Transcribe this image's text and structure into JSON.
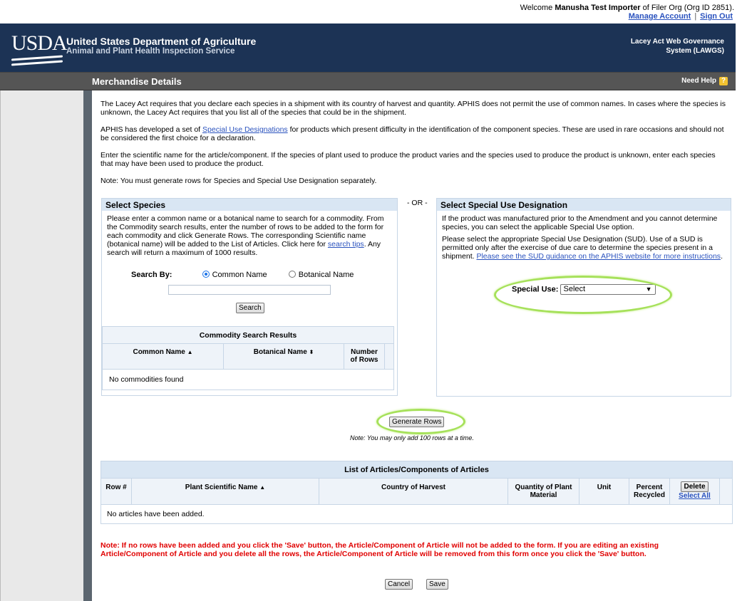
{
  "header": {
    "welcome_prefix": "Welcome",
    "user_name": "Manusha Test Importer",
    "org_text": "of Filer Org (Org ID 2851).",
    "manage_account": "Manage Account",
    "separator": "|",
    "sign_out": "Sign Out"
  },
  "banner": {
    "logo_text": "USDA",
    "dept_line1": "United States Department of Agriculture",
    "dept_line2": "Animal and Plant Health Inspection Service",
    "system_line1": "Lacey Act Web Governance",
    "system_line2": "System (LAWGS)"
  },
  "page": {
    "title": "Merchandise Details",
    "need_help": "Need Help",
    "help_glyph": "?"
  },
  "intro": {
    "p1": "The Lacey Act requires that you declare each species in a shipment with its country of harvest and quantity. APHIS does not permit the use of common names. In cases where the species is unknown, the Lacey Act requires that you list all of the species that could be in the shipment.",
    "p2_before": "APHIS has developed a set of ",
    "p2_link": "Special Use Designations",
    "p2_after": " for products which present difficulty in the identification of the component species. These are used in rare occasions and should not be considered the first choice for a declaration.",
    "p3": "Enter the scientific name for the article/component. If the species of plant used to produce the product varies and the species used to produce the product is unknown, enter each species that may have been used to produce the product.",
    "p4": "Note: You must generate rows for Species and Special Use Designation separately."
  },
  "species": {
    "heading": "Select Species",
    "desc_before": "Please enter a common name or a botanical name to search for a commodity. From the Commodity search results, enter the number of rows to be added to the form for each commodity and click Generate Rows. The corresponding Scientific name (botanical name) will be added to the List of Articles. Click here for ",
    "desc_link": "search tips",
    "desc_after": ". Any search will return a maximum of 1000 results.",
    "search_by_label": "Search By:",
    "option_common": "Common Name",
    "option_botanical": "Botanical Name",
    "selected_option": "Common Name",
    "search_value": "",
    "search_button": "Search",
    "results": {
      "caption": "Commodity Search Results",
      "col_common": "Common Name",
      "col_botanical": "Botanical Name",
      "col_rows_1": "Number",
      "col_rows_2": "of Rows",
      "sort_up": "▲",
      "sort_both": "⬍",
      "empty": "No commodities found"
    }
  },
  "or_label": "- OR -",
  "sud": {
    "heading": "Select Special Use Designation",
    "p1": "If the product was manufactured prior to the Amendment and you cannot determine species, you can select the applicable Special Use option.",
    "p2_before": "Please select the appropriate Special Use Designation (SUD). Use of a SUD is permitted only after the exercise of due care to determine the species present in a shipment. ",
    "p2_link": "Please see the SUD guidance on the APHIS website for more instructions",
    "p2_after": ".",
    "special_use_label": "Special Use:",
    "special_use_value": "Select"
  },
  "generate": {
    "button": "Generate Rows",
    "note": "Note: You may only add 100 rows at a time."
  },
  "articles": {
    "caption": "List of Articles/Components of Articles",
    "col_row": "Row #",
    "col_name": "Plant Scientific Name",
    "col_country": "Country of Harvest",
    "col_qty_1": "Quantity of Plant",
    "col_qty_2": "Material",
    "col_unit": "Unit",
    "col_pct_1": "Percent",
    "col_pct_2": "Recycled",
    "delete_button": "Delete",
    "select_all": "Select All",
    "sort_up": "▲",
    "empty": "No articles have been added."
  },
  "warning": "Note: If no rows have been added and you click the 'Save' button, the Article/Component of Article will not be added to the form. If you are editing an existing Article/Component of Article and you delete all the rows, the Article/Component of Article will be removed from this form once you click the 'Save' button.",
  "footer": {
    "cancel": "Cancel",
    "save": "Save"
  },
  "colors": {
    "banner": "#1c3355",
    "titlebar": "#555555",
    "panel_header": "#d9e6f3",
    "highlight_ring": "#a6e15a",
    "warning": "#e00000"
  }
}
